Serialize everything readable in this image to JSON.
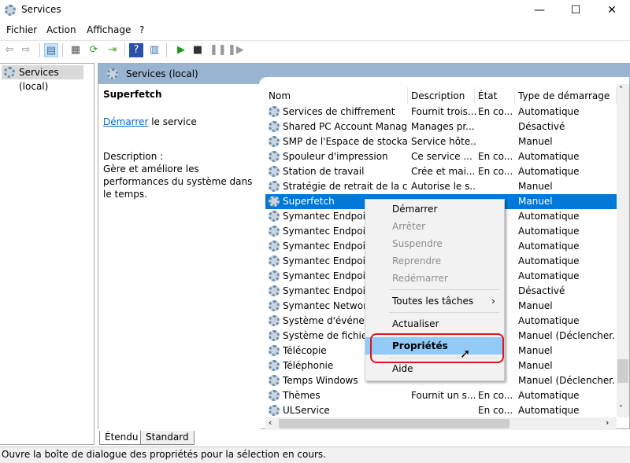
{
  "window": {
    "title": "Services",
    "minimize": "—",
    "maximize": "☐",
    "close": "✕"
  },
  "menu": [
    "Fichier",
    "Action",
    "Affichage",
    "?"
  ],
  "toolbar": [
    {
      "icon": "back-arrow-icon",
      "glyph": "⇦"
    },
    {
      "icon": "forward-arrow-icon",
      "glyph": "⇨"
    },
    {
      "icon": "show-hide-tree-icon",
      "glyph": "▤"
    },
    {
      "icon": "properties-icon",
      "glyph": "▦"
    },
    {
      "icon": "refresh-icon",
      "glyph": "⟳"
    },
    {
      "icon": "export-list-icon",
      "glyph": "⇥"
    },
    {
      "icon": "help-icon",
      "glyph": "?"
    },
    {
      "icon": "show-action-pane-icon",
      "glyph": "▥"
    },
    {
      "icon": "start-service-icon",
      "glyph": "▶"
    },
    {
      "icon": "stop-service-icon",
      "glyph": "■"
    },
    {
      "icon": "pause-service-icon",
      "glyph": "❚❚"
    },
    {
      "icon": "restart-service-icon",
      "glyph": "❚▶"
    }
  ],
  "tree": {
    "root": "Services (local)"
  },
  "pane": {
    "header": "Services (local)",
    "selected_name": "Superfetch",
    "start_link": "Démarrer",
    "start_suffix": " le service",
    "description_label": "Description :",
    "description_text": "Gère et améliore les performances du système dans le temps."
  },
  "columns": [
    "Nom",
    "Description",
    "État",
    "Type de démarrage"
  ],
  "rows": [
    {
      "name": "Services de chiffrement",
      "desc": "Fournit trois...",
      "state": "En co...",
      "type": "Automatique"
    },
    {
      "name": "Shared PC Account Manager",
      "desc": "Manages pr...",
      "state": "",
      "type": "Désactivé"
    },
    {
      "name": "SMP de l'Espace de stockag...",
      "desc": "Service hôte...",
      "state": "",
      "type": "Manuel"
    },
    {
      "name": "Spouleur d'impression",
      "desc": "Ce service ...",
      "state": "En co...",
      "type": "Automatique"
    },
    {
      "name": "Station de travail",
      "desc": "Crée et mai...",
      "state": "En co...",
      "type": "Automatique"
    },
    {
      "name": "Stratégie de retrait de la cart...",
      "desc": "Autorise le s...",
      "state": "",
      "type": "Manuel"
    },
    {
      "name": "Superfetch",
      "desc": "",
      "state": "",
      "type": "Manuel",
      "selected": true
    },
    {
      "name": "Symantec Endpoint",
      "desc": "",
      "state": "",
      "type": "Automatique"
    },
    {
      "name": "Symantec Endpoint",
      "desc": "",
      "state": "",
      "type": "Automatique"
    },
    {
      "name": "Symantec Endpoint",
      "desc": "",
      "state": "",
      "type": "Automatique"
    },
    {
      "name": "Symantec Endpoint",
      "desc": "",
      "state": "",
      "type": "Automatique"
    },
    {
      "name": "Symantec Endpoint",
      "desc": "",
      "state": "",
      "type": "Automatique"
    },
    {
      "name": "Symantec Endpoint",
      "desc": "",
      "state": "",
      "type": "Désactivé"
    },
    {
      "name": "Symantec Network",
      "desc": "",
      "state": "",
      "type": "Manuel"
    },
    {
      "name": "Système d'événeme",
      "desc": "",
      "state": "",
      "type": "Automatique"
    },
    {
      "name": "Système de fichiers",
      "desc": "",
      "state": "",
      "type": "Manuel (Déclencher..."
    },
    {
      "name": "Télécopie",
      "desc": "",
      "state": "",
      "type": "Manuel"
    },
    {
      "name": "Téléphonie",
      "desc": "",
      "state": "",
      "type": "Manuel"
    },
    {
      "name": "Temps Windows",
      "desc": "",
      "state": "",
      "type": "Manuel (Déclencher..."
    },
    {
      "name": "Thèmes",
      "desc": "Fournit un s...",
      "state": "En co...",
      "type": "Automatique"
    },
    {
      "name": "ULService",
      "desc": "",
      "state": "En co...",
      "type": "Automatique"
    }
  ],
  "context_menu": [
    {
      "label": "Démarrer",
      "disabled": false
    },
    {
      "label": "Arrêter",
      "disabled": true
    },
    {
      "label": "Suspendre",
      "disabled": true
    },
    {
      "label": "Reprendre",
      "disabled": true
    },
    {
      "label": "Redémarrer",
      "disabled": true
    },
    {
      "label": "Toutes les tâches",
      "disabled": false,
      "submenu": "›"
    },
    {
      "label": "Actualiser",
      "disabled": false
    },
    {
      "label": "Propriétés",
      "disabled": false,
      "highlighted": true
    },
    {
      "label": "Aide",
      "disabled": false
    }
  ],
  "tabs": [
    "Étendu",
    "Standard"
  ],
  "status": "Ouvre la boîte de dialogue des propriétés pour la sélection en cours.",
  "colors": {
    "selection": "#0078d7",
    "header_band": "#99b4d1",
    "menu_highlight": "#91c9f7",
    "annotation": "#e0141e"
  }
}
